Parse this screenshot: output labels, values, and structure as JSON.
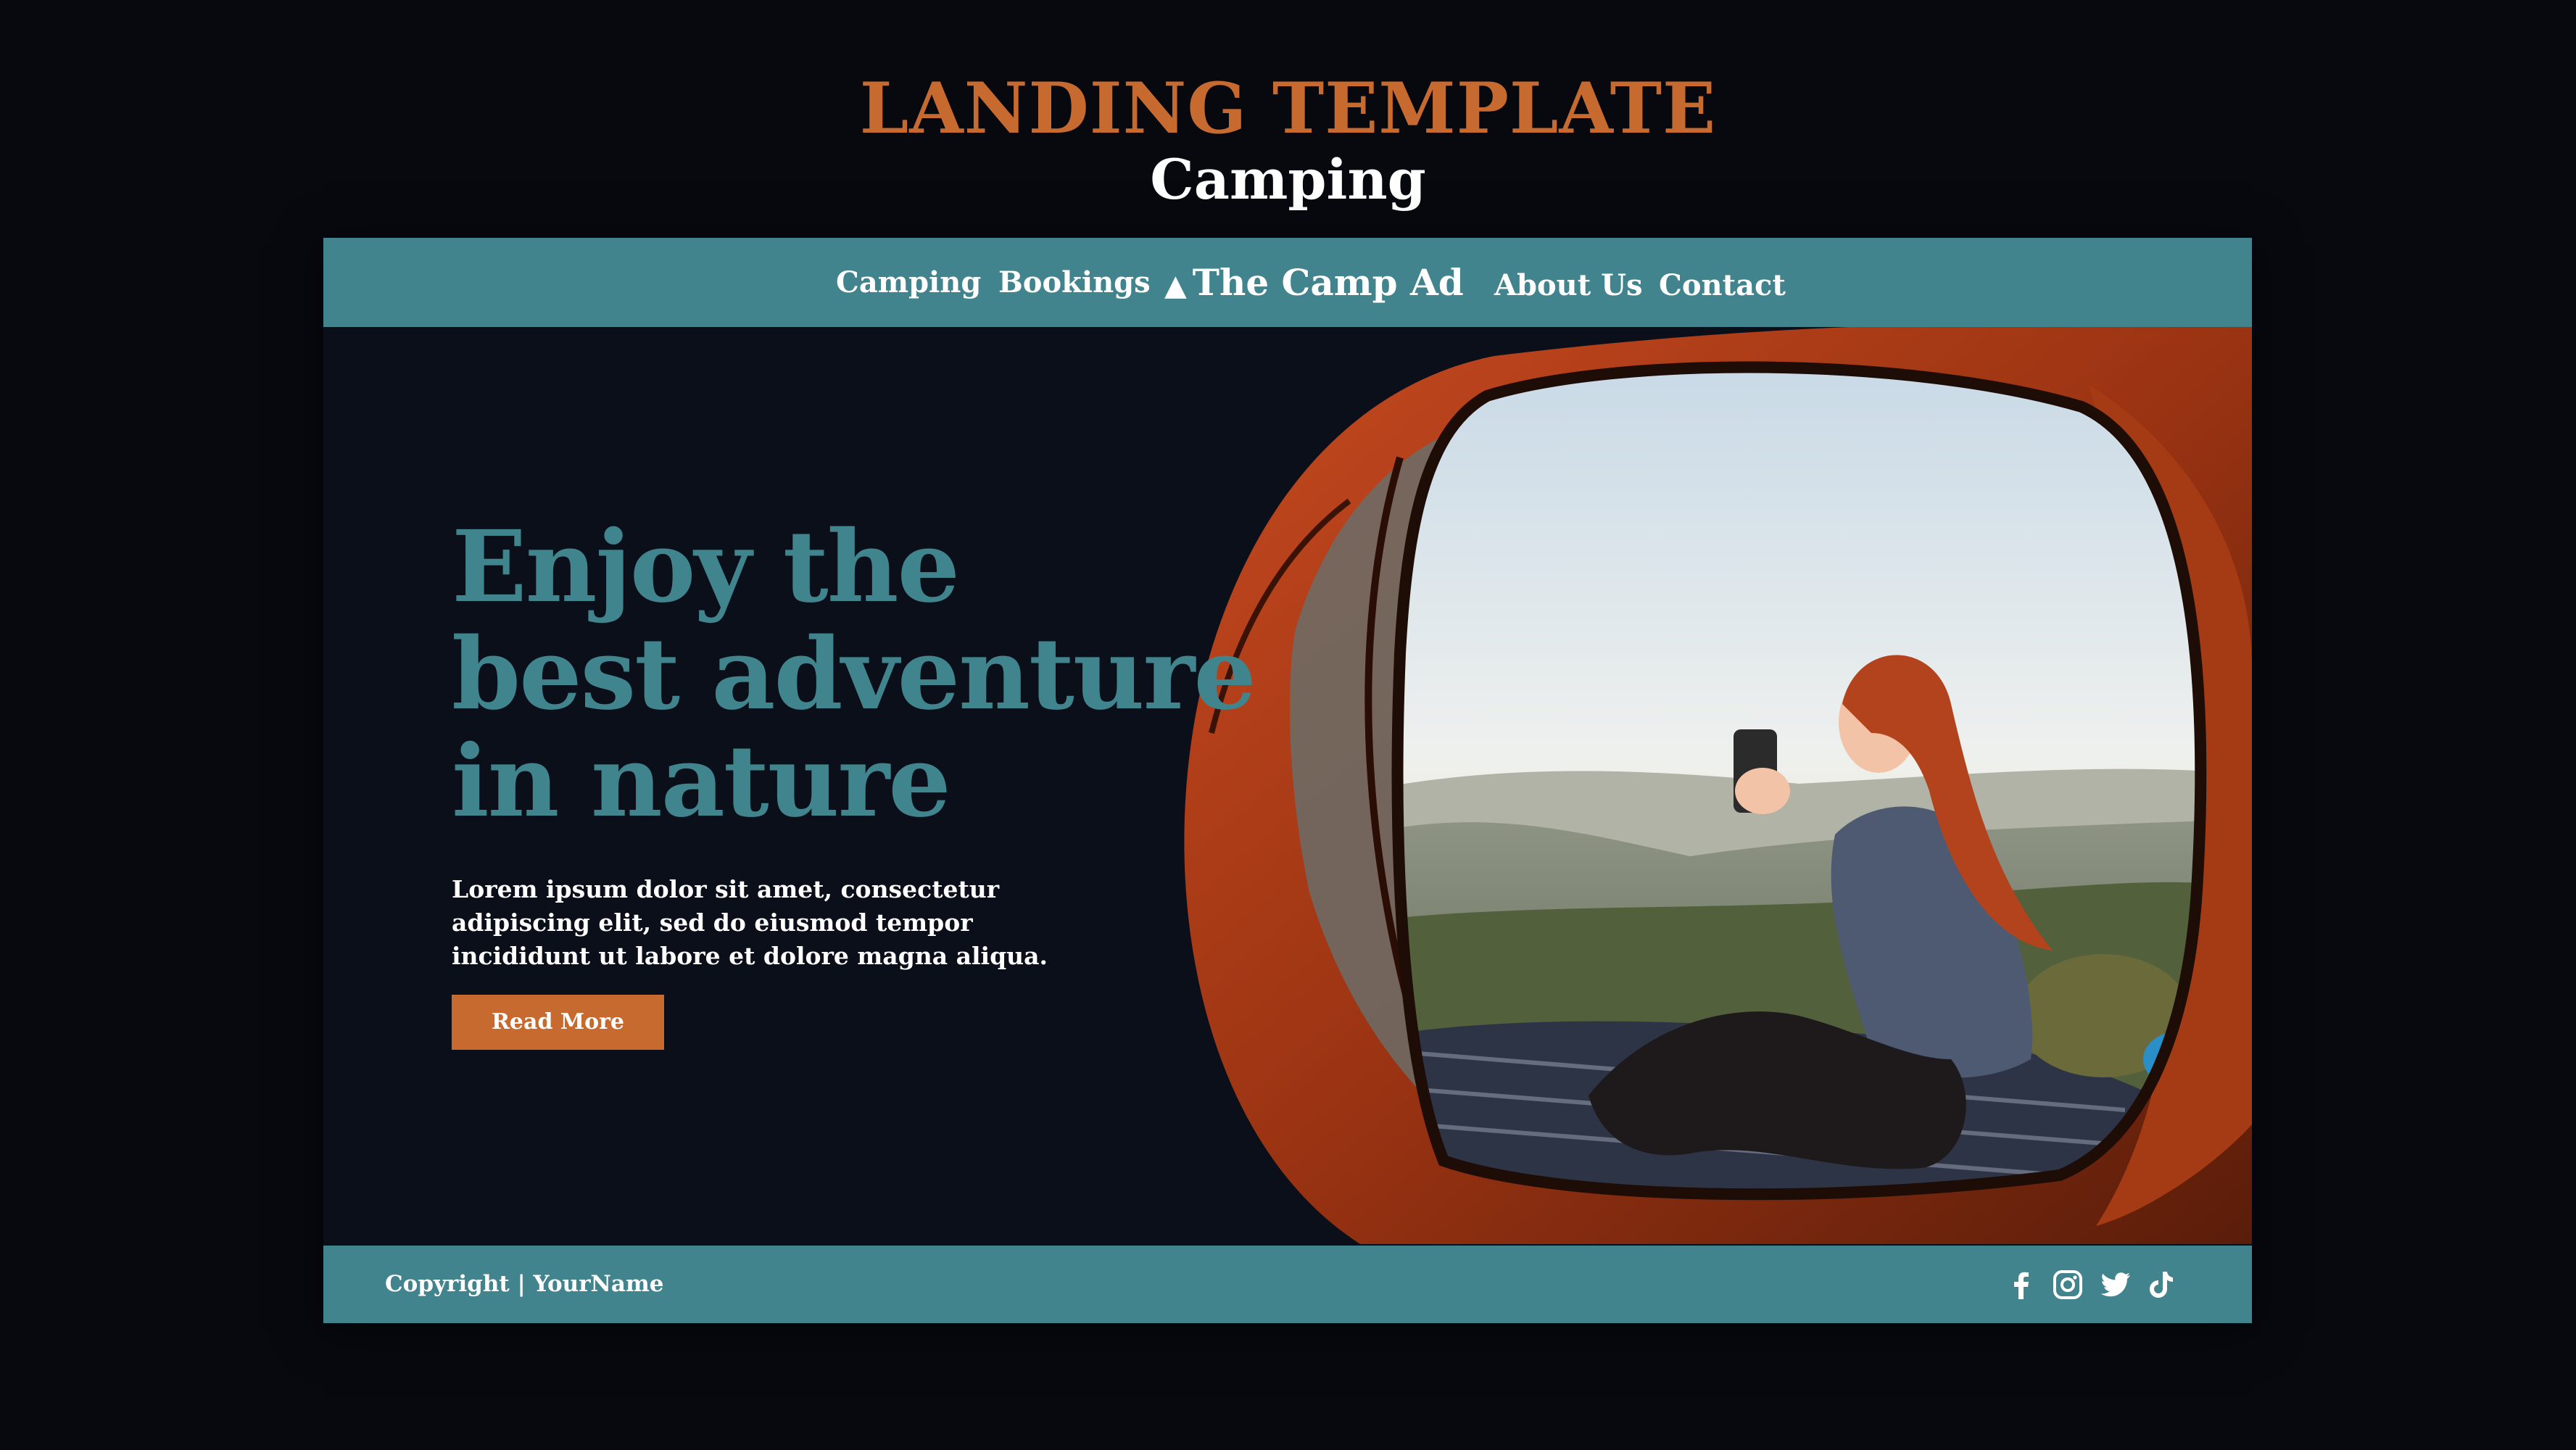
{
  "header": {
    "title": "LANDING TEMPLATE",
    "subtitle": "Camping"
  },
  "nav": {
    "items": [
      "Camping",
      "Bookings",
      "About Us",
      "Contact"
    ],
    "brand": "The Camp Ad",
    "brand_icon": "mountain-triangle-icon"
  },
  "hero": {
    "headline": [
      "Enjoy the",
      "best adventure",
      "in nature"
    ],
    "body": "Lorem ipsum dolor sit amet, consectetur adipiscing elit, sed do eiusmod tempor incididunt ut labore et dolore magna aliqua.",
    "cta_label": "Read More",
    "image_icon": "camping-photo-woman-in-tent"
  },
  "footer": {
    "copyright": "Copyright | YourName",
    "social_icons": [
      "facebook-icon",
      "instagram-icon",
      "twitter-icon",
      "tiktok-icon"
    ]
  },
  "colors": {
    "background": "#07090f",
    "panel": "#0b0f19",
    "teal": "#42848e",
    "orange": "#c66a30",
    "text_light": "#ffffff"
  }
}
